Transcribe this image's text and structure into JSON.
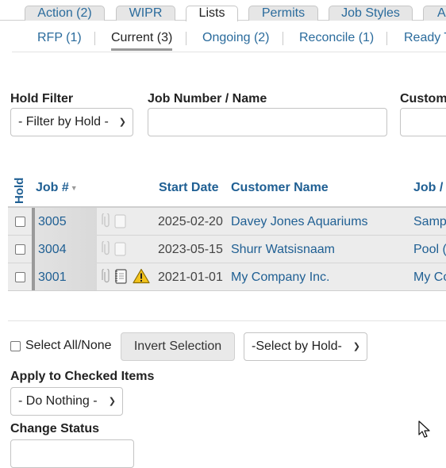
{
  "tabs": [
    {
      "label": "Action (2)",
      "active": false
    },
    {
      "label": "WIPR",
      "active": false
    },
    {
      "label": "Lists",
      "active": true
    },
    {
      "label": "Permits",
      "active": false
    },
    {
      "label": "Job Styles",
      "active": false
    },
    {
      "label": "A",
      "active": false
    }
  ],
  "subtabs": [
    {
      "label": "RFP (1)",
      "active": false
    },
    {
      "label": "Current (3)",
      "active": true
    },
    {
      "label": "Ongoing (2)",
      "active": false
    },
    {
      "label": "Reconcile (1)",
      "active": false
    },
    {
      "label": "Ready T",
      "active": false
    }
  ],
  "filters": {
    "hold_label": "Hold Filter",
    "hold_value": "- Filter by Hold -",
    "job_label": "Job Number / Name",
    "job_value": "",
    "customer_label": "Custom"
  },
  "table": {
    "headers": {
      "hold": "Hold",
      "job": "Job #",
      "start": "Start Date",
      "customer": "Customer Name",
      "jobname": "Job /"
    },
    "rows": [
      {
        "job": "3005",
        "start": "2025-02-20",
        "customer": "Davey Jones Aquariums",
        "jobname": "Samp",
        "warning": false
      },
      {
        "job": "3004",
        "start": "2023-05-15",
        "customer": "Shurr Watsisnaam",
        "jobname": "Pool (",
        "warning": false
      },
      {
        "job": "3001",
        "start": "2021-01-01",
        "customer": "My Company Inc.",
        "jobname": "My Co",
        "warning": true
      }
    ]
  },
  "actions": {
    "select_all_label": "Select All/None",
    "invert_label": "Invert Selection",
    "select_by_hold_value": "-Select by Hold-",
    "apply_label": "Apply to Checked Items",
    "apply_value": "- Do Nothing -",
    "status_label": "Change Status"
  },
  "colors": {
    "link": "#1f5f93",
    "row_bg": "#ececec",
    "warning": "#f2c21b"
  }
}
